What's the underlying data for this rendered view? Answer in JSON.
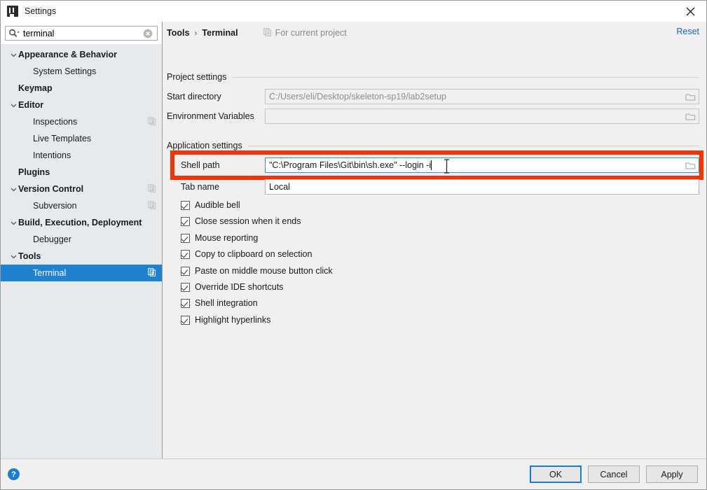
{
  "window": {
    "title": "Settings",
    "app_icon": "intellij-idea-icon",
    "close_icon": "close-icon"
  },
  "search": {
    "value": "terminal",
    "placeholder": "Search settings",
    "search_icon": "search-icon",
    "clear_icon": "clear-icon"
  },
  "sidebar": {
    "items": [
      {
        "label": "Appearance & Behavior",
        "level": 0,
        "bold": true,
        "expanded": true,
        "arrow": true,
        "selected": false,
        "module_icon": false
      },
      {
        "label": "System Settings",
        "level": 1,
        "bold": false,
        "expanded": false,
        "arrow": false,
        "selected": false,
        "module_icon": false
      },
      {
        "label": "Keymap",
        "level": 0,
        "bold": true,
        "expanded": false,
        "arrow": false,
        "selected": false,
        "module_icon": false
      },
      {
        "label": "Editor",
        "level": 0,
        "bold": true,
        "expanded": true,
        "arrow": true,
        "selected": false,
        "module_icon": false
      },
      {
        "label": "Inspections",
        "level": 1,
        "bold": false,
        "expanded": false,
        "arrow": false,
        "selected": false,
        "module_icon": true
      },
      {
        "label": "Live Templates",
        "level": 1,
        "bold": false,
        "expanded": false,
        "arrow": false,
        "selected": false,
        "module_icon": false
      },
      {
        "label": "Intentions",
        "level": 1,
        "bold": false,
        "expanded": false,
        "arrow": false,
        "selected": false,
        "module_icon": false
      },
      {
        "label": "Plugins",
        "level": 0,
        "bold": true,
        "expanded": false,
        "arrow": false,
        "selected": false,
        "module_icon": false
      },
      {
        "label": "Version Control",
        "level": 0,
        "bold": true,
        "expanded": true,
        "arrow": true,
        "selected": false,
        "module_icon": true
      },
      {
        "label": "Subversion",
        "level": 1,
        "bold": false,
        "expanded": false,
        "arrow": false,
        "selected": false,
        "module_icon": true
      },
      {
        "label": "Build, Execution, Deployment",
        "level": 0,
        "bold": true,
        "expanded": true,
        "arrow": true,
        "selected": false,
        "module_icon": false
      },
      {
        "label": "Debugger",
        "level": 1,
        "bold": false,
        "expanded": false,
        "arrow": false,
        "selected": false,
        "module_icon": false
      },
      {
        "label": "Tools",
        "level": 0,
        "bold": true,
        "expanded": true,
        "arrow": true,
        "selected": false,
        "module_icon": false
      },
      {
        "label": "Terminal",
        "level": 1,
        "bold": false,
        "expanded": false,
        "arrow": false,
        "selected": true,
        "module_icon": true
      }
    ]
  },
  "header": {
    "crumb_parent": "Tools",
    "crumb_separator": "›",
    "crumb_current": "Terminal",
    "scope_note": "For current project",
    "scope_icon": "module-icon",
    "reset_label": "Reset"
  },
  "project_settings": {
    "section_title": "Project settings",
    "start_directory": {
      "label": "Start directory",
      "value": "C:/Users/eli/Desktop/skeleton-sp19/lab2setup",
      "browse_icon": "folder-icon"
    },
    "environment_variables": {
      "label": "Environment Variables",
      "value": "",
      "browse_icon": "folder-icon"
    }
  },
  "application_settings": {
    "section_title": "Application settings",
    "shell_path": {
      "label": "Shell path",
      "value": "\"C:\\Program Files\\Git\\bin\\sh.exe\" --login -i",
      "browse_icon": "folder-icon",
      "focused": true,
      "highlight_color": "#f53100"
    },
    "tab_name": {
      "label": "Tab name",
      "value": "Local"
    },
    "checkboxes": [
      {
        "label": "Audible bell",
        "checked": true
      },
      {
        "label": "Close session when it ends",
        "checked": true
      },
      {
        "label": "Mouse reporting",
        "checked": true
      },
      {
        "label": "Copy to clipboard on selection",
        "checked": true
      },
      {
        "label": "Paste on middle mouse button click",
        "checked": true
      },
      {
        "label": "Override IDE shortcuts",
        "checked": true
      },
      {
        "label": "Shell integration",
        "checked": true
      },
      {
        "label": "Highlight hyperlinks",
        "checked": true
      }
    ]
  },
  "footer": {
    "help_label": "?",
    "ok_label": "OK",
    "cancel_label": "Cancel",
    "apply_label": "Apply"
  },
  "colors": {
    "accent_blue": "#1e82d1",
    "link_blue": "#1667c1",
    "highlight_red": "#f53100",
    "sidebar_bg": "#e6eaed",
    "panel_bg": "#f0f0f0"
  }
}
